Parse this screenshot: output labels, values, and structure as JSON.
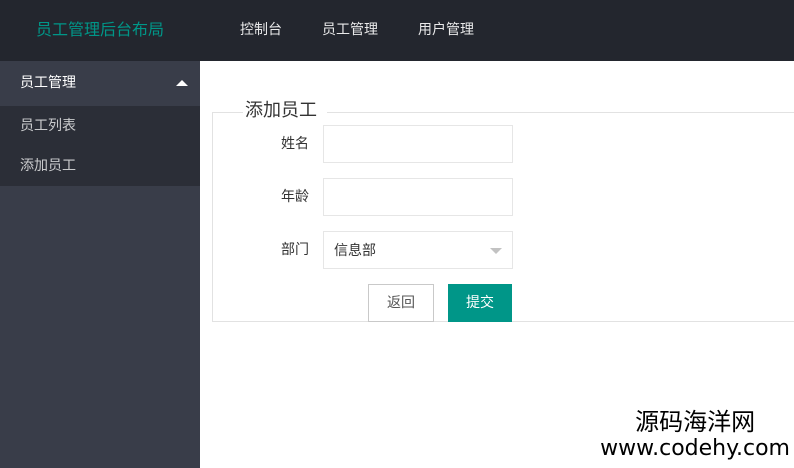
{
  "header": {
    "logo": "员工管理后台布局",
    "nav": [
      "控制台",
      "员工管理",
      "用户管理"
    ]
  },
  "sidebar": {
    "group_label": "员工管理",
    "items": [
      "员工列表",
      "添加员工"
    ]
  },
  "form": {
    "legend": "添加员工",
    "name_label": "姓名",
    "name_value": "",
    "age_label": "年龄",
    "age_value": "",
    "dept_label": "部门",
    "dept_selected": "信息部",
    "back_label": "返回",
    "submit_label": "提交"
  },
  "watermark": {
    "line1": "源码海洋网",
    "line2": "www.codehy.com"
  },
  "colors": {
    "header_bg": "#23262e",
    "sidebar_bg": "#393d49",
    "submenu_bg": "#2b2e37",
    "accent": "#009688"
  },
  "icons": {
    "sidebar_group_toggle": "caret-up-icon",
    "select_toggle": "caret-down-icon"
  }
}
